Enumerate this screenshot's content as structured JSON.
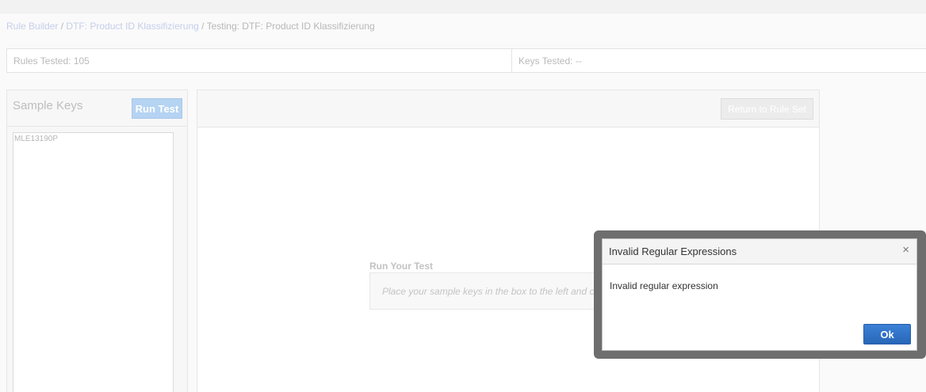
{
  "breadcrumb": {
    "items": [
      "Rule Builder",
      "DTF: Product ID Klassifizierung"
    ],
    "separator": "/",
    "current": "Testing: DTF: Product ID Klassifizierung"
  },
  "stats": {
    "rules_tested": "Rules Tested: 105",
    "keys_tested": "Keys Tested: --"
  },
  "sample_panel": {
    "title": "Sample Keys",
    "run_test_label": "Run Test",
    "textarea_value": "MLE13190P"
  },
  "main_panel": {
    "return_label": "Return to Rule Set",
    "run_your_test_label": "Run Your Test",
    "run_your_test_hint": "Place your sample keys in the box to the left and click"
  },
  "dialog": {
    "title": "Invalid Regular Expressions",
    "close_glyph": "×",
    "message": "Invalid regular expression",
    "ok_label": "Ok"
  },
  "colors": {
    "primary_button": "#2f72c8",
    "disabled_button": "#b5d3f2",
    "link": "#c5ceea"
  }
}
